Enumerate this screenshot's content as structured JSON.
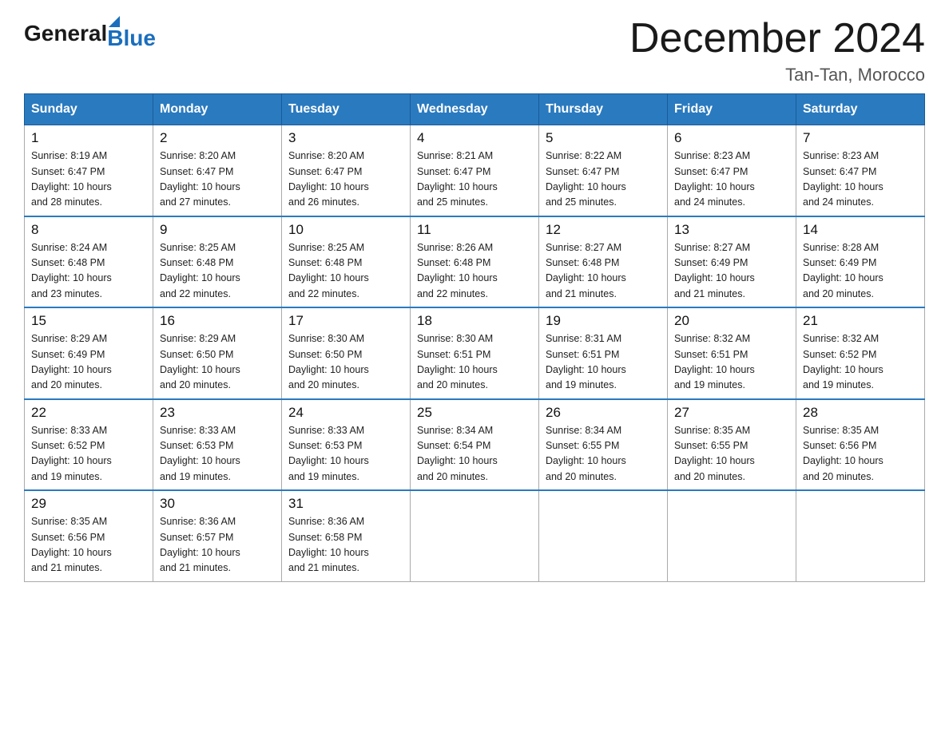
{
  "logo": {
    "general": "General",
    "blue": "Blue"
  },
  "title": "December 2024",
  "location": "Tan-Tan, Morocco",
  "days_of_week": [
    "Sunday",
    "Monday",
    "Tuesday",
    "Wednesday",
    "Thursday",
    "Friday",
    "Saturday"
  ],
  "weeks": [
    [
      {
        "day": "1",
        "sunrise": "8:19 AM",
        "sunset": "6:47 PM",
        "daylight": "10 hours and 28 minutes."
      },
      {
        "day": "2",
        "sunrise": "8:20 AM",
        "sunset": "6:47 PM",
        "daylight": "10 hours and 27 minutes."
      },
      {
        "day": "3",
        "sunrise": "8:20 AM",
        "sunset": "6:47 PM",
        "daylight": "10 hours and 26 minutes."
      },
      {
        "day": "4",
        "sunrise": "8:21 AM",
        "sunset": "6:47 PM",
        "daylight": "10 hours and 25 minutes."
      },
      {
        "day": "5",
        "sunrise": "8:22 AM",
        "sunset": "6:47 PM",
        "daylight": "10 hours and 25 minutes."
      },
      {
        "day": "6",
        "sunrise": "8:23 AM",
        "sunset": "6:47 PM",
        "daylight": "10 hours and 24 minutes."
      },
      {
        "day": "7",
        "sunrise": "8:23 AM",
        "sunset": "6:47 PM",
        "daylight": "10 hours and 24 minutes."
      }
    ],
    [
      {
        "day": "8",
        "sunrise": "8:24 AM",
        "sunset": "6:48 PM",
        "daylight": "10 hours and 23 minutes."
      },
      {
        "day": "9",
        "sunrise": "8:25 AM",
        "sunset": "6:48 PM",
        "daylight": "10 hours and 22 minutes."
      },
      {
        "day": "10",
        "sunrise": "8:25 AM",
        "sunset": "6:48 PM",
        "daylight": "10 hours and 22 minutes."
      },
      {
        "day": "11",
        "sunrise": "8:26 AM",
        "sunset": "6:48 PM",
        "daylight": "10 hours and 22 minutes."
      },
      {
        "day": "12",
        "sunrise": "8:27 AM",
        "sunset": "6:48 PM",
        "daylight": "10 hours and 21 minutes."
      },
      {
        "day": "13",
        "sunrise": "8:27 AM",
        "sunset": "6:49 PM",
        "daylight": "10 hours and 21 minutes."
      },
      {
        "day": "14",
        "sunrise": "8:28 AM",
        "sunset": "6:49 PM",
        "daylight": "10 hours and 20 minutes."
      }
    ],
    [
      {
        "day": "15",
        "sunrise": "8:29 AM",
        "sunset": "6:49 PM",
        "daylight": "10 hours and 20 minutes."
      },
      {
        "day": "16",
        "sunrise": "8:29 AM",
        "sunset": "6:50 PM",
        "daylight": "10 hours and 20 minutes."
      },
      {
        "day": "17",
        "sunrise": "8:30 AM",
        "sunset": "6:50 PM",
        "daylight": "10 hours and 20 minutes."
      },
      {
        "day": "18",
        "sunrise": "8:30 AM",
        "sunset": "6:51 PM",
        "daylight": "10 hours and 20 minutes."
      },
      {
        "day": "19",
        "sunrise": "8:31 AM",
        "sunset": "6:51 PM",
        "daylight": "10 hours and 19 minutes."
      },
      {
        "day": "20",
        "sunrise": "8:32 AM",
        "sunset": "6:51 PM",
        "daylight": "10 hours and 19 minutes."
      },
      {
        "day": "21",
        "sunrise": "8:32 AM",
        "sunset": "6:52 PM",
        "daylight": "10 hours and 19 minutes."
      }
    ],
    [
      {
        "day": "22",
        "sunrise": "8:33 AM",
        "sunset": "6:52 PM",
        "daylight": "10 hours and 19 minutes."
      },
      {
        "day": "23",
        "sunrise": "8:33 AM",
        "sunset": "6:53 PM",
        "daylight": "10 hours and 19 minutes."
      },
      {
        "day": "24",
        "sunrise": "8:33 AM",
        "sunset": "6:53 PM",
        "daylight": "10 hours and 19 minutes."
      },
      {
        "day": "25",
        "sunrise": "8:34 AM",
        "sunset": "6:54 PM",
        "daylight": "10 hours and 20 minutes."
      },
      {
        "day": "26",
        "sunrise": "8:34 AM",
        "sunset": "6:55 PM",
        "daylight": "10 hours and 20 minutes."
      },
      {
        "day": "27",
        "sunrise": "8:35 AM",
        "sunset": "6:55 PM",
        "daylight": "10 hours and 20 minutes."
      },
      {
        "day": "28",
        "sunrise": "8:35 AM",
        "sunset": "6:56 PM",
        "daylight": "10 hours and 20 minutes."
      }
    ],
    [
      {
        "day": "29",
        "sunrise": "8:35 AM",
        "sunset": "6:56 PM",
        "daylight": "10 hours and 21 minutes."
      },
      {
        "day": "30",
        "sunrise": "8:36 AM",
        "sunset": "6:57 PM",
        "daylight": "10 hours and 21 minutes."
      },
      {
        "day": "31",
        "sunrise": "8:36 AM",
        "sunset": "6:58 PM",
        "daylight": "10 hours and 21 minutes."
      },
      null,
      null,
      null,
      null
    ]
  ],
  "labels": {
    "sunrise": "Sunrise:",
    "sunset": "Sunset:",
    "daylight": "Daylight:"
  }
}
